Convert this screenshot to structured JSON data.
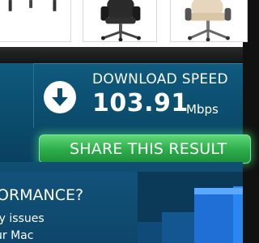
{
  "products": {
    "items": [
      {
        "name": "",
        "icon": "chair-legs-image"
      },
      {
        "name": "",
        "icon": "black-office-chair-image"
      },
      {
        "name": "",
        "icon": "beige-office-chair-image"
      }
    ]
  },
  "result": {
    "download_label": "DOWNLOAD SPEED",
    "download_value": "103.91",
    "download_unit": "Mbps",
    "download_icon": "download-arrow-icon"
  },
  "share": {
    "label": "SHARE THIS RESULT"
  },
  "promo": {
    "heading": "ORMANCE?",
    "line1": "fy issues",
    "line2": "ur Mac"
  },
  "colors": {
    "panel": "#0b4c6c",
    "share_green": "#2fae4c",
    "text": "#ffffff"
  }
}
